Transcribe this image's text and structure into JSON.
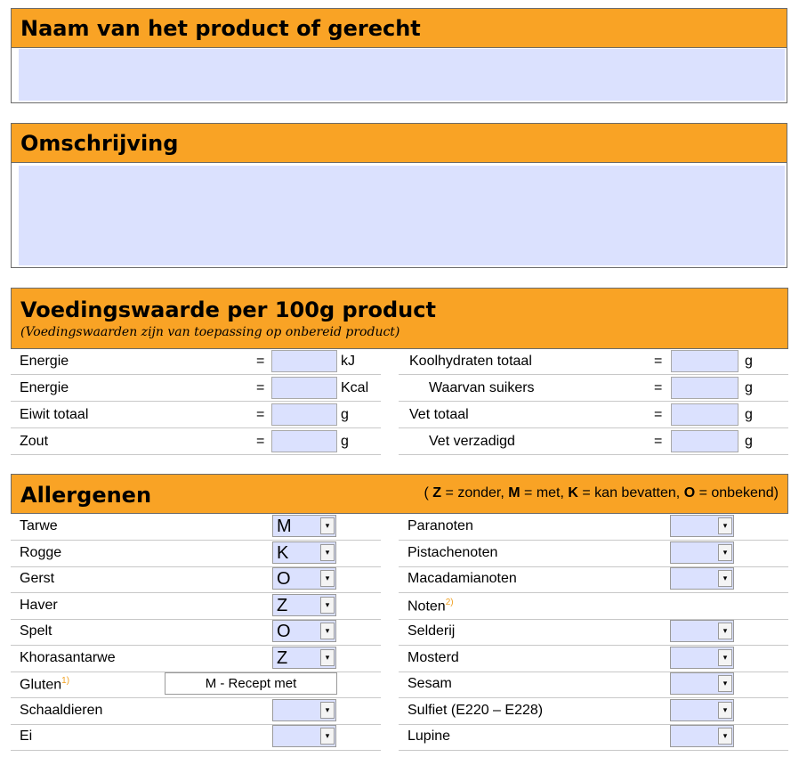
{
  "colors": {
    "accent": "#f9a325",
    "field": "#dbe1fe"
  },
  "name_section": {
    "title": "Naam van het product of gerecht",
    "value": ""
  },
  "description_section": {
    "title": "Omschrijving",
    "value": ""
  },
  "nutrition": {
    "title": "Voedingswaarde per 100g product",
    "subtitle": "(Voedingswaarden zijn van toepassing op onbereid product)",
    "left": [
      {
        "label": "Energie",
        "eq": "=",
        "unit": "kJ",
        "value": ""
      },
      {
        "label": "Energie",
        "eq": "=",
        "unit": "Kcal",
        "value": ""
      },
      {
        "label": "Eiwit totaal",
        "eq": "=",
        "unit": "g",
        "value": ""
      },
      {
        "label": "Zout",
        "eq": "=",
        "unit": "g",
        "value": ""
      }
    ],
    "right": [
      {
        "label": "Koolhydraten totaal",
        "eq": "=",
        "unit": "g",
        "value": ""
      },
      {
        "label": "Waarvan suikers",
        "eq": "=",
        "unit": "g",
        "value": ""
      },
      {
        "label": "Vet totaal",
        "eq": "=",
        "unit": "g",
        "value": ""
      },
      {
        "label": "Vet verzadigd",
        "eq": "=",
        "unit": "g",
        "value": ""
      }
    ]
  },
  "allergens": {
    "title": "Allergenen",
    "legend": {
      "z": "Z",
      "z_text": " = zonder, ",
      "m": "M",
      "m_text": " = met, ",
      "k": "K",
      "k_text": " = kan bevatten, ",
      "o": "O",
      "o_text": " = onbekend)",
      "open": "( "
    },
    "left": [
      {
        "label": "Tarwe",
        "value": "M"
      },
      {
        "label": "Rogge",
        "value": "K"
      },
      {
        "label": "Gerst",
        "value": "O"
      },
      {
        "label": "Haver",
        "value": "Z"
      },
      {
        "label": "Spelt",
        "value": "O"
      },
      {
        "label": "Khorasantarwe",
        "value": "Z"
      },
      {
        "label": "Gluten",
        "footnote": "1)",
        "readonly_value": "M - Recept met"
      },
      {
        "label": "Schaaldieren",
        "value": ""
      },
      {
        "label": "Ei",
        "value": ""
      }
    ],
    "right": [
      {
        "label": "Paranoten",
        "value": ""
      },
      {
        "label": "Pistachenoten",
        "value": ""
      },
      {
        "label": "Macadamianoten",
        "value": ""
      },
      {
        "label": "Noten",
        "footnote": "2)"
      },
      {
        "label": "Selderij",
        "value": ""
      },
      {
        "label": "Mosterd",
        "value": ""
      },
      {
        "label": "Sesam",
        "value": ""
      },
      {
        "label": "Sulfiet (E220 – E228)",
        "value": ""
      },
      {
        "label": "Lupine",
        "value": ""
      }
    ],
    "dropdown_glyph": "▾"
  }
}
